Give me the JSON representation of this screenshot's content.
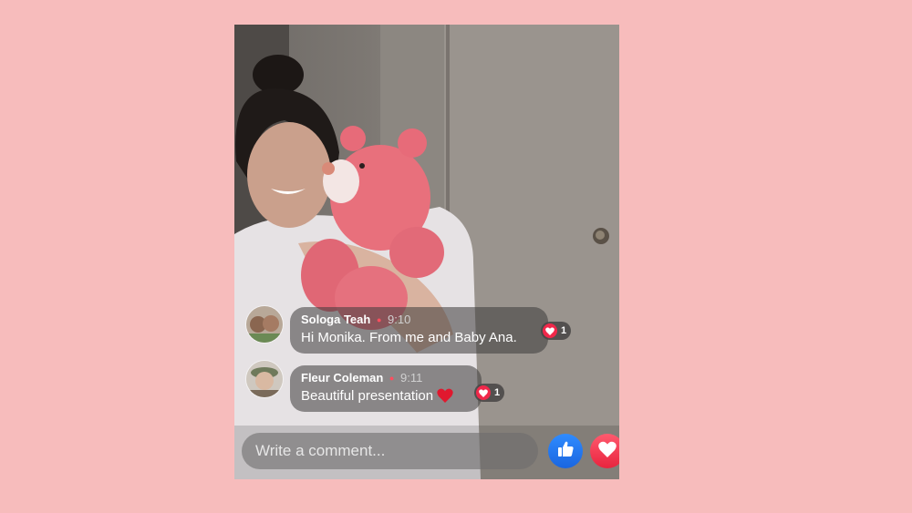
{
  "comments": [
    {
      "author": "Sologa Teah",
      "time": "9:10",
      "text": "Hi Monika.  From me and Baby Ana.",
      "reactions": "1"
    },
    {
      "author": "Fleur Coleman",
      "time": "9:11",
      "text": "Beautiful presentation",
      "emoji": "❤️",
      "reactions": "1"
    }
  ],
  "composer": {
    "placeholder": "Write a comment..."
  },
  "icons": {
    "like": "thumbs-up-icon",
    "love": "heart-icon"
  },
  "colors": {
    "background": "#f7bcbc",
    "like_blue": "#1a66e0",
    "love_red": "#e8243e"
  }
}
